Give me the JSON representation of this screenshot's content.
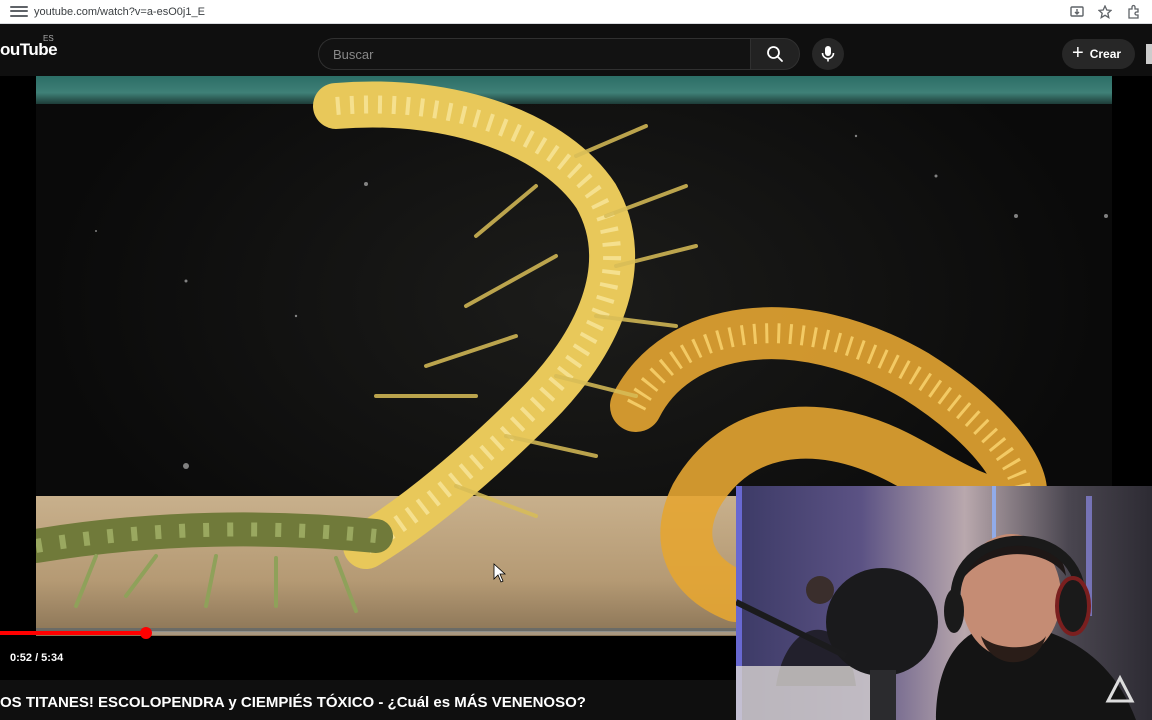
{
  "browser": {
    "url": "youtube.com/watch?v=a-esO0j1_E"
  },
  "header": {
    "logo_text": "ouTube",
    "logo_region": "ES",
    "search_placeholder": "Buscar",
    "create_label": "Crear"
  },
  "player": {
    "time_display": "0:52 / 5:34",
    "progress_fraction": 0.156
  },
  "video": {
    "title": "OS TITANES! ESCOLOPENDRA y CIEMPIÉS TÓXICO - ¿Cuál es MÁS VENENOSO?"
  },
  "colors": {
    "progress": "#ff0000",
    "background": "#0f0f0f"
  }
}
